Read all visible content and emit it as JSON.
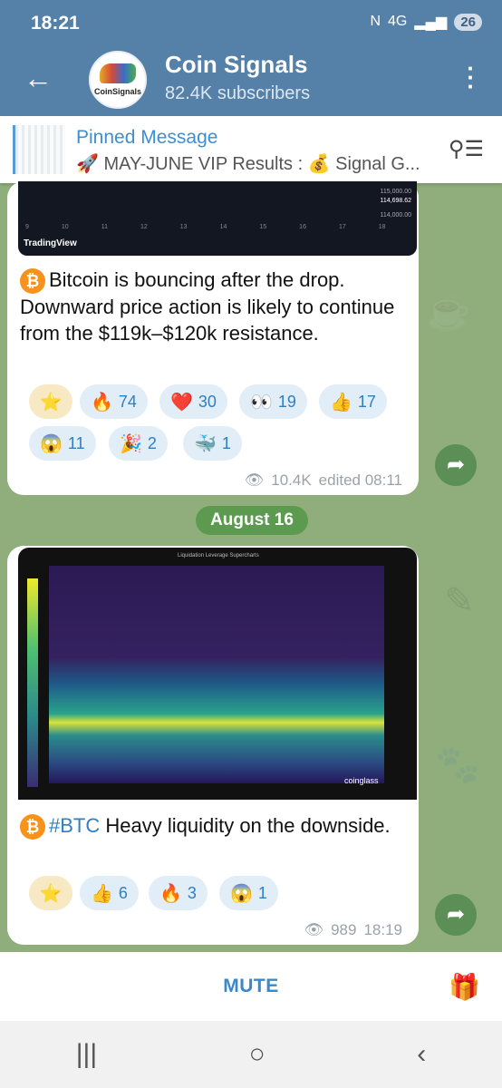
{
  "status": {
    "time": "18:21",
    "network": "4G",
    "battery": "26"
  },
  "header": {
    "title": "Coin Signals",
    "subtitle": "82.4K subscribers",
    "avatar_text": "CoinSignals"
  },
  "pinned": {
    "title": "Pinned Message",
    "text": "🚀 MAY-JUNE VIP Results : 💰 Signal G..."
  },
  "msg1": {
    "chart_source": "TradingView",
    "axis_ticks": [
      "9",
      "10",
      "11",
      "12",
      "13",
      "14",
      "15",
      "16",
      "17",
      "18"
    ],
    "price_top": "115,000.00",
    "price_mid": "114,698.62",
    "price_bot": "114,000.00",
    "text": "Bitcoin is bouncing after the drop. Downward price action is likely to continue from the $119k–$120k resistance.",
    "reactions": [
      {
        "emoji": "🔥",
        "count": "74"
      },
      {
        "emoji": "❤️",
        "count": "30"
      },
      {
        "emoji": "👀",
        "count": "19"
      },
      {
        "emoji": "👍",
        "count": "17"
      },
      {
        "emoji": "😱",
        "count": "11"
      },
      {
        "emoji": "🎉",
        "count": "2"
      },
      {
        "emoji": "🐳",
        "count": "1"
      }
    ],
    "views": "10.4K",
    "time": "edited 08:11"
  },
  "date_label": "August 16",
  "msg2": {
    "chart_legend": "Liquidation Leverage  Supercharts",
    "chart_watermark": "coinglass",
    "hashtag": "#BTC",
    "text": " Heavy liquidity on the downside.",
    "reactions": [
      {
        "emoji": "👍",
        "count": "6"
      },
      {
        "emoji": "🔥",
        "count": "3"
      },
      {
        "emoji": "😱",
        "count": "1"
      }
    ],
    "views": "989",
    "time": "18:19"
  },
  "bottom": {
    "mute": "MUTE"
  }
}
